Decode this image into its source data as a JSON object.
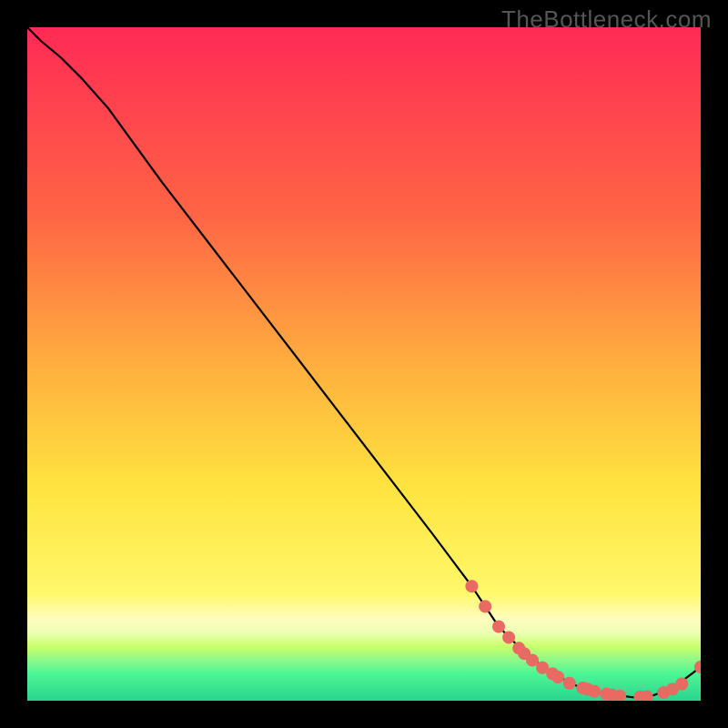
{
  "watermark": "TheBottleneck.com",
  "chart_data": {
    "type": "line",
    "title": "",
    "xlabel": "",
    "ylabel": "",
    "xlim": [
      0,
      100
    ],
    "ylim": [
      0,
      100
    ],
    "grid": false,
    "background_gradient": {
      "top": "#ff2a55",
      "mid_upper": "#ffae3f",
      "mid": "#ffe33f",
      "mid_lower": "#fff86a",
      "band": "#c8ff6a",
      "bottom": "#2bf48f"
    },
    "series": [
      {
        "name": "bottleneck-curve",
        "x": [
          0,
          2,
          5,
          8,
          12,
          20,
          30,
          40,
          50,
          60,
          66,
          70,
          74,
          78,
          82,
          86,
          90,
          93,
          96,
          100
        ],
        "y": [
          100,
          98,
          95.5,
          92.5,
          88,
          77,
          64,
          51,
          38,
          25,
          17,
          11,
          7,
          4,
          2,
          1,
          0.5,
          0.8,
          2,
          5
        ]
      }
    ],
    "markers": {
      "name": "highlight-points",
      "color": "#e86a63",
      "x": [
        66,
        68,
        70,
        71.5,
        73,
        73.8,
        75,
        76.5,
        78,
        78.8,
        80.5,
        82.5,
        83.2,
        84.2,
        86,
        86.8,
        88,
        91,
        92,
        94.5,
        95.8,
        97.2,
        100
      ],
      "y": [
        17,
        14,
        11,
        9.4,
        7.8,
        7,
        6,
        4.9,
        4,
        3.5,
        2.6,
        1.9,
        1.7,
        1.4,
        1,
        0.85,
        0.7,
        0.55,
        0.6,
        1.2,
        1.7,
        2.5,
        5
      ]
    }
  }
}
